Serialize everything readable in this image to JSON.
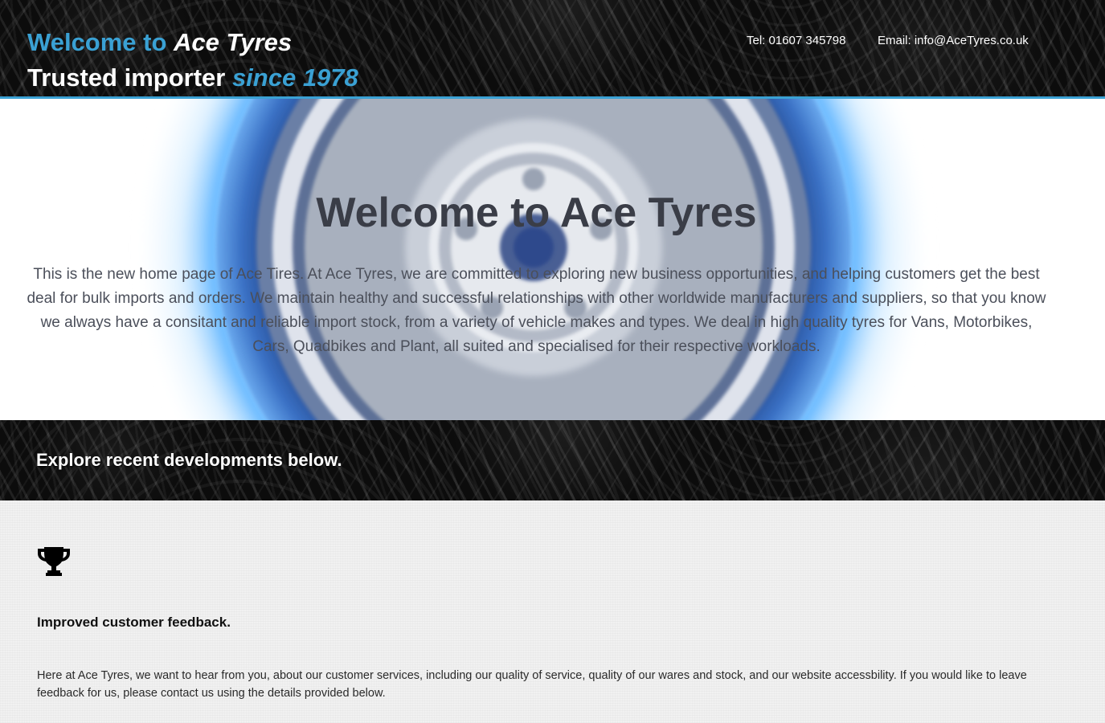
{
  "header": {
    "brand_welcome": "Welcome to ",
    "brand_name": "Ace Tyres",
    "tagline_prefix": "Trusted importer ",
    "tagline_since": "since 1978",
    "tel": "Tel: 01607 345798",
    "email": "Email: info@AceTyres.co.uk"
  },
  "hero": {
    "title": "Welcome to Ace Tyres",
    "text": "This is the new home page of Ace Tires. At Ace Tyres, we are committed to exploring new business opportunities, and helping customers get the best deal for bulk imports and orders. We maintain healthy and successful relationships with other worldwide manufacturers and suppliers, so that you know we always have a consitant and reliable import stock, from a variety of vehicle makes and types. We deal in high quality tyres for Vans, Motorbikes, Cars, Quadbikes and Plant, all suited and specialised for their respective workloads."
  },
  "banner": {
    "text": "Explore recent developments below."
  },
  "feature": {
    "icon": "trophy-icon",
    "title": "Improved customer feedback.",
    "text": "Here at Ace Tyres, we want to hear from you, about our customer services, including our quality of service, quality of our wares and stock, and our website accessbility. If you would like to leave feedback for us, please contact us using the details provided below."
  },
  "colors": {
    "accent": "#3aa1d4",
    "header_bg": "#0c0c0c",
    "hero_title": "#3a3d47",
    "hero_text": "#4b4f5a",
    "content_bg": "#f1f1f1"
  }
}
